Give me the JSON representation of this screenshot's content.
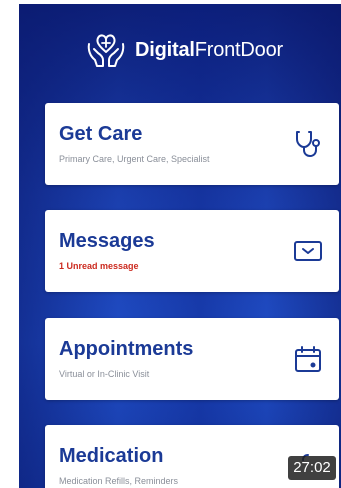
{
  "brand": {
    "name_bold": "Digital",
    "name_light": "FrontDoor",
    "logo": "hands-heart-cross-icon"
  },
  "cards": [
    {
      "title": "Get Care",
      "subtitle": "Primary Care, Urgent Care, Specialist",
      "icon": "stethoscope-icon"
    },
    {
      "title": "Messages",
      "subtitle": "1 Unread message",
      "subtitle_color": "#cc2a1f",
      "icon": "mail-icon"
    },
    {
      "title": "Appointments",
      "subtitle": "Virtual or In-Clinic Visit",
      "icon": "calendar-icon"
    },
    {
      "title": "Medication",
      "subtitle": "Medication Refills, Reminders",
      "icon": "pill-icon"
    }
  ],
  "overlay": {
    "timer": "27:02"
  },
  "colors": {
    "accent": "#1b3a96",
    "background": "#1b3fae",
    "alert": "#cc2a1f"
  }
}
